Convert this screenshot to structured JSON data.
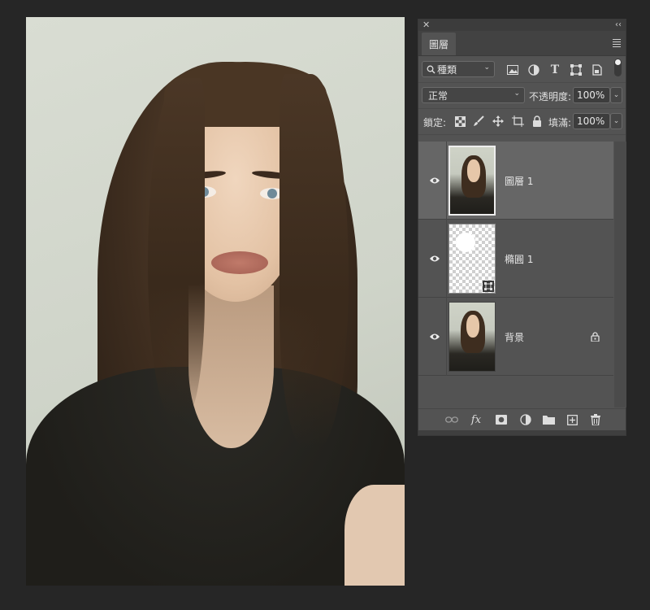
{
  "panel": {
    "tab_label": "圖層",
    "filter_select": "種類",
    "blend_mode": "正常",
    "opacity_label": "不透明度:",
    "opacity_value": "100%",
    "lock_label": "鎖定:",
    "fill_label": "填滿:",
    "fill_value": "100%"
  },
  "layers": [
    {
      "name": "圖層 1",
      "selected": true,
      "visible": true,
      "thumb": "photo"
    },
    {
      "name": "橢圓 1",
      "selected": false,
      "visible": true,
      "thumb": "shape"
    },
    {
      "name": "背景",
      "selected": false,
      "visible": true,
      "thumb": "photo",
      "locked": true
    }
  ],
  "icons": {
    "topbar": [
      "close-icon",
      "collapse-icon",
      "panel-menu-icon"
    ],
    "filter": [
      "search-icon",
      "image-filter-icon",
      "adjustment-filter-icon",
      "type-filter-icon",
      "shape-filter-icon",
      "smart-object-filter-icon"
    ],
    "lock": [
      "lock-transparent-icon",
      "lock-image-icon",
      "lock-position-icon",
      "lock-artboard-icon",
      "lock-all-icon"
    ],
    "bottom": [
      "link-layers-icon",
      "fx-icon",
      "add-mask-icon",
      "adjustment-layer-icon",
      "new-group-icon",
      "new-layer-icon",
      "delete-icon"
    ]
  }
}
